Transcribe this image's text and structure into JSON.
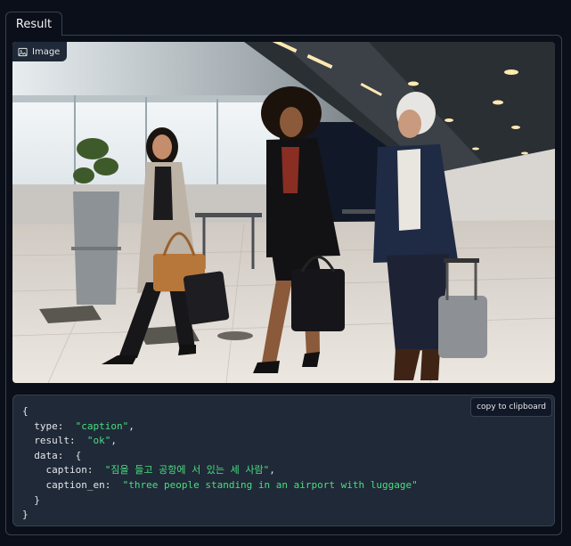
{
  "tab": {
    "label": "Result"
  },
  "image": {
    "label": "Image",
    "icon": "image-icon",
    "description_icon": "photo"
  },
  "copy": {
    "label": "copy to clipboard"
  },
  "json_output": {
    "type_key": "type",
    "type_value": "\"caption\"",
    "result_key": "result",
    "result_value": "\"ok\"",
    "data_key": "data",
    "caption_key": "caption",
    "caption_value": "\"짐을 들고 공항에 서 있는 세 사람\"",
    "caption_en_key": "caption_en",
    "caption_en_value": "\"three people standing in an airport with luggage\""
  },
  "colors": {
    "background": "#0b0f19",
    "panel_border": "#374151",
    "code_bg": "#1f2937",
    "string": "#4ade80"
  }
}
